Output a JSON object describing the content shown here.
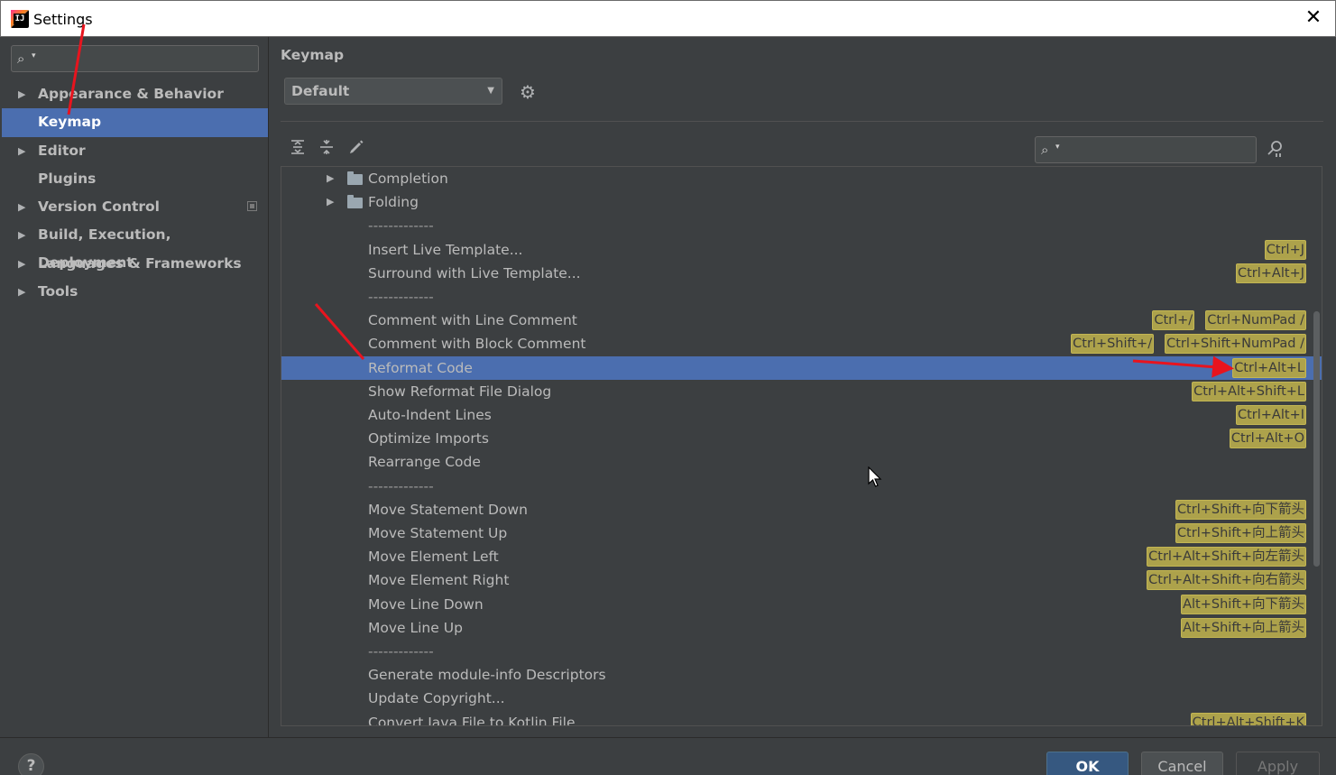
{
  "window": {
    "title": "Settings"
  },
  "sidebar": {
    "search_placeholder": "",
    "items": [
      {
        "label": "Appearance & Behavior",
        "expandable": true,
        "active": false
      },
      {
        "label": "Keymap",
        "expandable": false,
        "active": true
      },
      {
        "label": "Editor",
        "expandable": true,
        "active": false
      },
      {
        "label": "Plugins",
        "expandable": false,
        "active": false
      },
      {
        "label": "Version Control",
        "expandable": true,
        "active": false
      },
      {
        "label": "Build, Execution, Deployment",
        "expandable": true,
        "active": false
      },
      {
        "label": "Languages & Frameworks",
        "expandable": true,
        "active": false
      },
      {
        "label": "Tools",
        "expandable": true,
        "active": false
      }
    ]
  },
  "main": {
    "title": "Keymap",
    "scheme": "Default",
    "search_placeholder": ""
  },
  "tree": {
    "rows": [
      {
        "label": "Completion",
        "folder": true,
        "shortcuts": []
      },
      {
        "label": "Folding",
        "folder": true,
        "shortcuts": []
      },
      {
        "label": "-------------",
        "separator": true,
        "shortcuts": []
      },
      {
        "label": "Insert Live Template...",
        "shortcuts": [
          "Ctrl+J"
        ]
      },
      {
        "label": "Surround with Live Template...",
        "shortcuts": [
          "Ctrl+Alt+J"
        ]
      },
      {
        "label": "-------------",
        "separator": true,
        "shortcuts": []
      },
      {
        "label": "Comment with Line Comment",
        "shortcuts": [
          "Ctrl+/",
          "Ctrl+NumPad /"
        ]
      },
      {
        "label": "Comment with Block Comment",
        "shortcuts": [
          "Ctrl+Shift+/",
          "Ctrl+Shift+NumPad /"
        ]
      },
      {
        "label": "Reformat Code",
        "selected": true,
        "shortcuts": [
          "Ctrl+Alt+L"
        ]
      },
      {
        "label": "Show Reformat File Dialog",
        "shortcuts": [
          "Ctrl+Alt+Shift+L"
        ]
      },
      {
        "label": "Auto-Indent Lines",
        "shortcuts": [
          "Ctrl+Alt+I"
        ]
      },
      {
        "label": "Optimize Imports",
        "shortcuts": [
          "Ctrl+Alt+O"
        ]
      },
      {
        "label": "Rearrange Code",
        "shortcuts": []
      },
      {
        "label": "-------------",
        "separator": true,
        "shortcuts": []
      },
      {
        "label": "Move Statement Down",
        "shortcuts": [
          "Ctrl+Shift+向下箭头"
        ]
      },
      {
        "label": "Move Statement Up",
        "shortcuts": [
          "Ctrl+Shift+向上箭头"
        ]
      },
      {
        "label": "Move Element Left",
        "shortcuts": [
          "Ctrl+Alt+Shift+向左箭头"
        ]
      },
      {
        "label": "Move Element Right",
        "shortcuts": [
          "Ctrl+Alt+Shift+向右箭头"
        ]
      },
      {
        "label": "Move Line Down",
        "shortcuts": [
          "Alt+Shift+向下箭头"
        ]
      },
      {
        "label": "Move Line Up",
        "shortcuts": [
          "Alt+Shift+向上箭头"
        ]
      },
      {
        "label": "-------------",
        "separator": true,
        "shortcuts": []
      },
      {
        "label": "Generate module-info Descriptors",
        "shortcuts": []
      },
      {
        "label": "Update Copyright...",
        "shortcuts": []
      },
      {
        "label": "Convert Java File to Kotlin File",
        "shortcuts": [
          "Ctrl+Alt+Shift+K"
        ]
      }
    ]
  },
  "footer": {
    "help_label": "?",
    "ok_label": "OK",
    "cancel_label": "Cancel",
    "apply_label": "Apply"
  },
  "colors": {
    "selection": "#4b6eaf",
    "shortcut_badge": "#ada24b",
    "annotation_arrow": "#e8141e",
    "ok_button": "#365880"
  },
  "icons": {
    "search": "search-icon",
    "gear": "gear-icon",
    "expand_all": "expand-all-icon",
    "collapse_all": "collapse-all-icon",
    "edit": "edit-icon",
    "find_by_shortcut": "find-shortcut-icon",
    "close": "close-icon",
    "help": "help-icon"
  }
}
